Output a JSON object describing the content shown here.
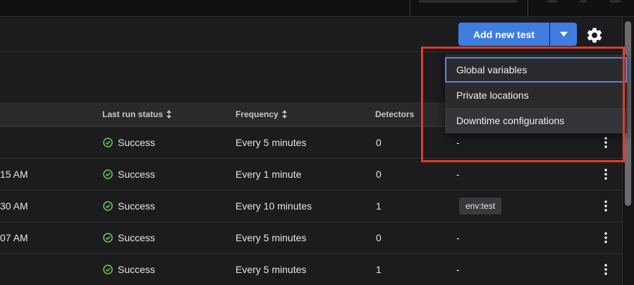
{
  "toolbar": {
    "add_button_label": "Add new test",
    "dropdown_caret_icon": "caret-down-icon",
    "settings_icon": "gear-icon"
  },
  "table": {
    "columns": [
      {
        "label": "Last run status",
        "sortable": true
      },
      {
        "label": "Frequency",
        "sortable": true
      },
      {
        "label": "Detectors",
        "sortable": false
      }
    ],
    "rows": [
      {
        "time": "",
        "status": "Success",
        "frequency": "Every 5 minutes",
        "detectors": "0",
        "tags": "-"
      },
      {
        "time": "15 AM",
        "status": "Success",
        "frequency": "Every 1 minute",
        "detectors": "0",
        "tags": "-"
      },
      {
        "time": "30 AM",
        "status": "Success",
        "frequency": "Every 10 minutes",
        "detectors": "1",
        "tags": "env:test"
      },
      {
        "time": "07 AM",
        "status": "Success",
        "frequency": "Every 5 minutes",
        "detectors": "0",
        "tags": "-"
      },
      {
        "time": "",
        "status": "Success",
        "frequency": "Every 5 minutes",
        "detectors": "1",
        "tags": "-"
      }
    ]
  },
  "menu": {
    "items": [
      {
        "label": "Global variables",
        "state": "focused"
      },
      {
        "label": "Private locations",
        "state": "normal"
      },
      {
        "label": "Downtime configurations",
        "state": "hover"
      }
    ]
  },
  "colors": {
    "accent": "#3f7de0",
    "success": "#6fcf4a",
    "highlight": "#e23a2c"
  }
}
